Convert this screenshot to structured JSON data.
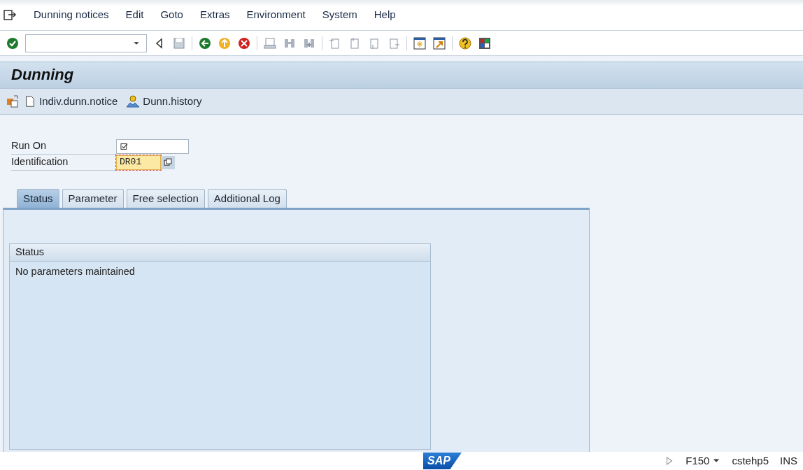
{
  "menu_bar": {
    "items": [
      "Dunning notices",
      "Edit",
      "Goto",
      "Extras",
      "Environment",
      "System",
      "Help"
    ]
  },
  "screen_title": "Dunning",
  "app_toolbar": {
    "buttons": [
      {
        "kind": "icon"
      },
      {
        "kind": "document",
        "label": "Indiv.dunn.notice"
      },
      {
        "kind": "person",
        "label": "Dunn.history"
      }
    ]
  },
  "form": {
    "fields": [
      {
        "label": "Run On",
        "kind": "checkbox-field"
      },
      {
        "label": "Identification",
        "kind": "search-field",
        "value": "DR01",
        "highlighted": true
      }
    ]
  },
  "tabs": [
    {
      "label": "Status",
      "selected": true
    },
    {
      "label": "Parameter",
      "selected": false
    },
    {
      "label": "Free selection",
      "selected": false
    },
    {
      "label": "Additional Log",
      "selected": false
    }
  ],
  "status_group": {
    "title": "Status",
    "text": "No parameters maintained"
  },
  "status_bar": {
    "logo": "SAP",
    "transaction": "F150",
    "server": "cstehp5",
    "mode": "INS"
  }
}
